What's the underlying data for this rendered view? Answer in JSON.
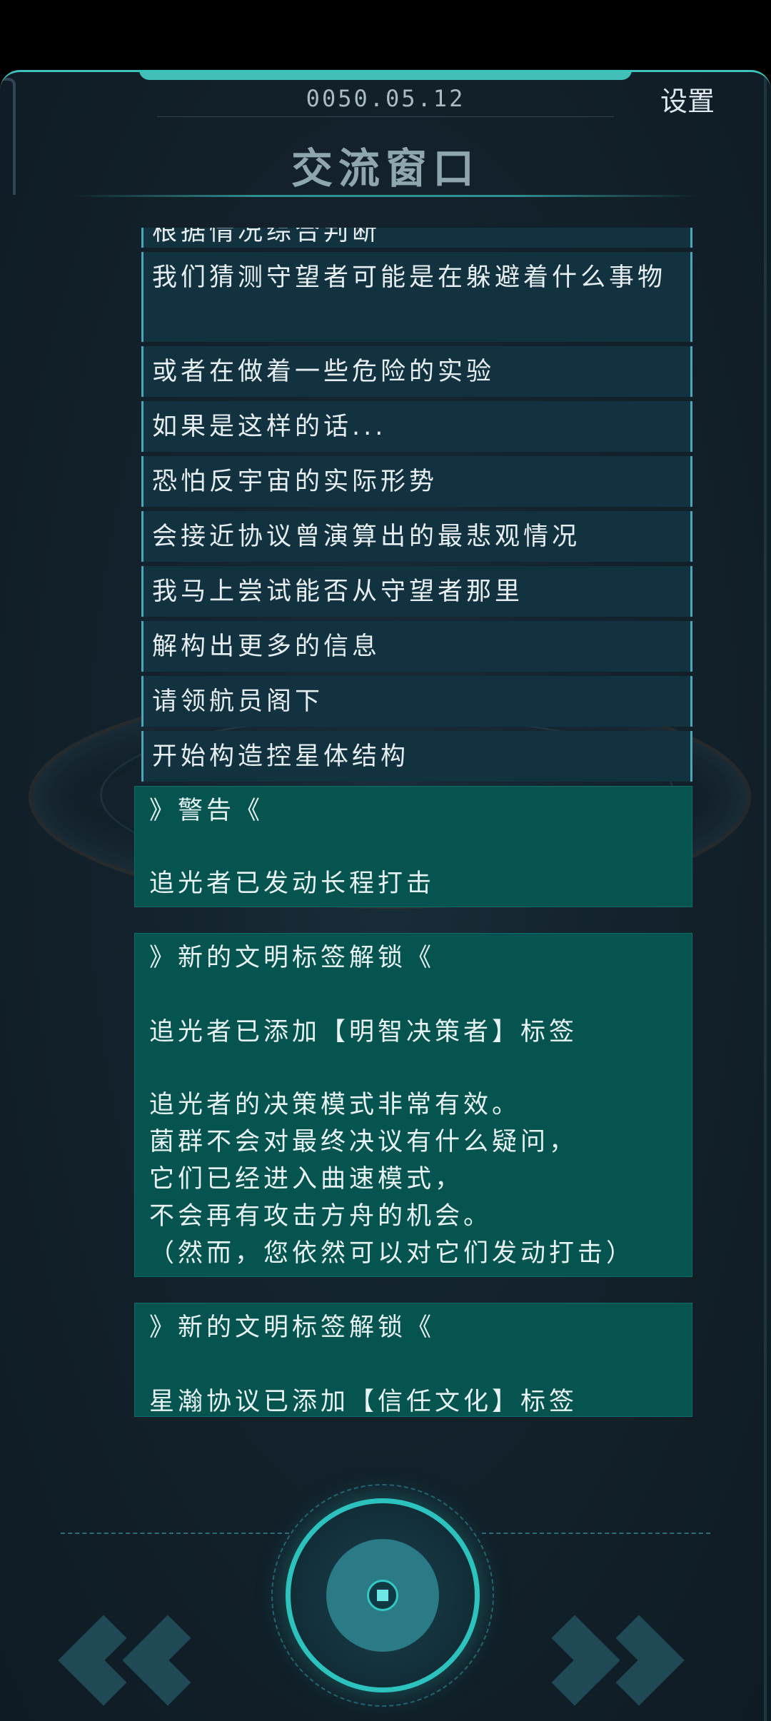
{
  "header": {
    "date": "0050.05.12",
    "settings_label": "设置",
    "title": "交流窗口"
  },
  "messages": [
    "根据情况综合判断",
    "我们猜测守望者可能是在躲避着什么事物",
    "或者在做着一些危险的实验",
    "如果是这样的话...",
    "恐怕反宇宙的实际形势",
    "会接近协议曾演算出的最悲观情况",
    "我马上尝试能否从守望者那里",
    "解构出更多的信息",
    "请领航员阁下",
    "开始构造控星体结构"
  ],
  "cards": [
    {
      "header": "》警告《",
      "lines": [
        "追光者已发动长程打击"
      ]
    },
    {
      "header": "》新的文明标签解锁《",
      "lines": [
        "追光者已添加【明智决策者】标签",
        "追光者的决策模式非常有效。\n菌群不会对最终决议有什么疑问，\n它们已经进入曲速模式，\n不会再有攻击方舟的机会。\n（然而，您依然可以对它们发动打击）"
      ]
    },
    {
      "header": "》新的文明标签解锁《",
      "lines": [
        "星瀚协议已添加【信任文化】标签"
      ]
    }
  ],
  "controls": {
    "prev_icon": "double-chevron-left-icon",
    "center_icon": "center-target-button-icon",
    "next_icon": "double-chevron-right-icon"
  },
  "colors": {
    "accent": "#3cc3bb",
    "message_bg": "#13323f",
    "card_bg": "#065450",
    "background": "#13222c"
  }
}
